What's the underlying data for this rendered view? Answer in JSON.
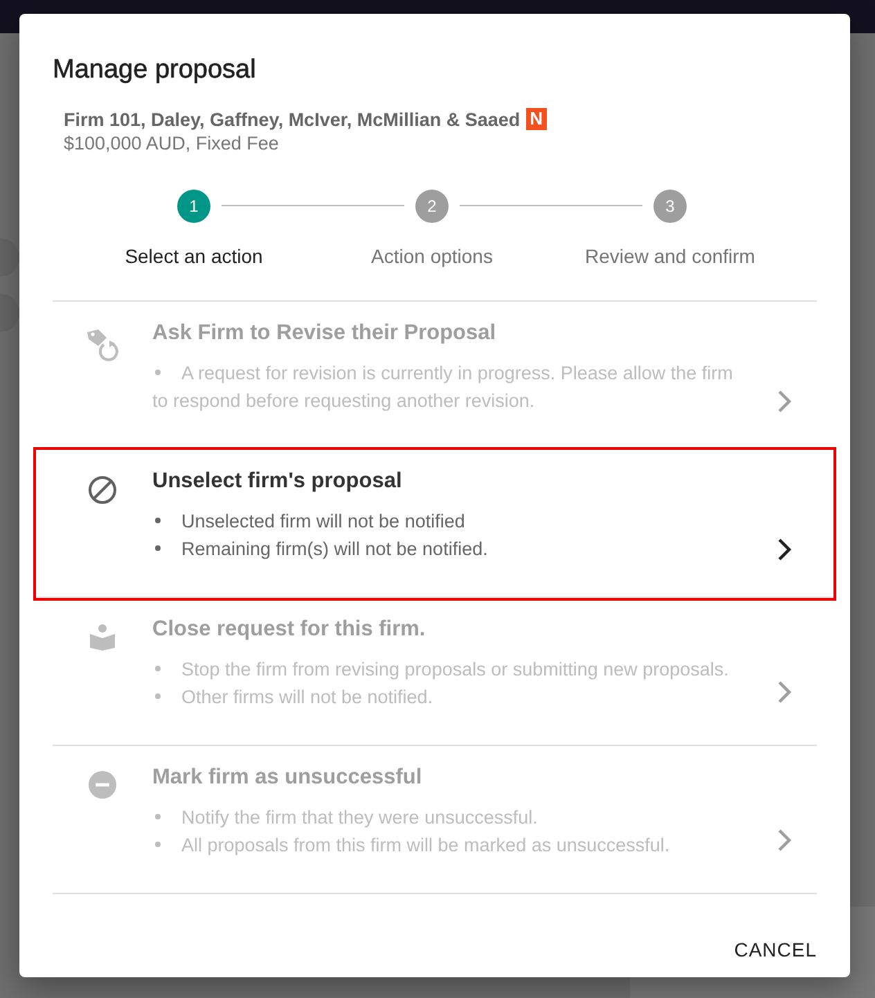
{
  "dialog": {
    "title": "Manage proposal",
    "firm": {
      "name": "Firm 101, Daley, Gaffney, McIver, McMillian & Saaed",
      "badge": "N",
      "fee": "$100,000 AUD, Fixed Fee"
    },
    "steps": [
      {
        "number": "1",
        "label": "Select an action",
        "selected": true
      },
      {
        "number": "2",
        "label": "Action options",
        "selected": false
      },
      {
        "number": "3",
        "label": "Review and confirm",
        "selected": false
      }
    ],
    "actions": [
      {
        "kind": "tag-refresh",
        "title": "Ask Firm to Revise their Proposal",
        "disabled": true,
        "selected": false,
        "bullets": [
          "A request for revision is currently in progress. Please allow the firm to respond before requesting another revision."
        ]
      },
      {
        "kind": "ban",
        "title": "Unselect firm's proposal",
        "disabled": false,
        "selected": true,
        "bullets": [
          "Unselected firm will not be notified",
          "Remaining firm(s) will not be notified."
        ]
      },
      {
        "kind": "book-person",
        "title": "Close request for this firm.",
        "disabled": true,
        "selected": false,
        "bullets": [
          "Stop the firm from revising proposals or submitting new proposals.",
          "Other firms will not be notified."
        ]
      },
      {
        "kind": "minus-circle",
        "title": "Mark firm as unsuccessful",
        "disabled": true,
        "selected": false,
        "bullets": [
          "Notify the firm that they were unsuccessful.",
          "All proposals from this firm will be marked as unsuccessful."
        ]
      }
    ],
    "buttons": [
      {
        "label": "CANCEL"
      }
    ]
  }
}
